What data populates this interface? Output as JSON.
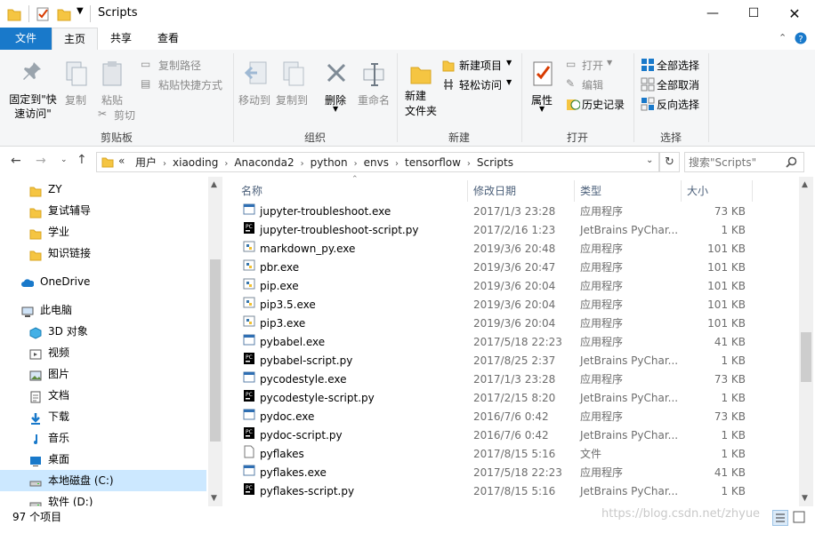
{
  "window": {
    "title": "Scripts"
  },
  "tabs": {
    "file": "文件",
    "home": "主页",
    "share": "共享",
    "view": "查看"
  },
  "ribbon": {
    "pin": "固定到\"快速访问\"",
    "copy": "复制",
    "paste": "粘贴",
    "copy_path": "复制路径",
    "paste_shortcut": "粘贴快捷方式",
    "cut": "剪切",
    "group_clipboard": "剪贴板",
    "move_to": "移动到",
    "copy_to": "复制到",
    "delete": "删除",
    "rename": "重命名",
    "group_organize": "组织",
    "new_folder": "新建\n文件夹",
    "new_item": "新建项目",
    "easy_access": "轻松访问",
    "group_new": "新建",
    "properties": "属性",
    "open": "打开",
    "edit": "编辑",
    "history": "历史记录",
    "group_open": "打开",
    "select_all": "全部选择",
    "select_none": "全部取消",
    "invert": "反向选择",
    "group_select": "选择"
  },
  "address": {
    "chevrons": "«",
    "path": [
      "用户",
      "xiaoding",
      "Anaconda2",
      "python",
      "envs",
      "tensorflow",
      "Scripts"
    ],
    "search_placeholder": "搜索\"Scripts\""
  },
  "nav": [
    {
      "label": "ZY",
      "icon": "folder-icon"
    },
    {
      "label": "复试辅导",
      "icon": "folder-icon"
    },
    {
      "label": "学业",
      "icon": "folder-icon"
    },
    {
      "label": "知识链接",
      "icon": "folder-icon"
    },
    {
      "label": "OneDrive",
      "icon": "cloud-icon"
    },
    {
      "label": "此电脑",
      "icon": "computer-icon"
    },
    {
      "label": "3D 对象",
      "icon": "cube-icon"
    },
    {
      "label": "视频",
      "icon": "video-icon"
    },
    {
      "label": "图片",
      "icon": "picture-icon"
    },
    {
      "label": "文档",
      "icon": "document-icon"
    },
    {
      "label": "下载",
      "icon": "download-icon"
    },
    {
      "label": "音乐",
      "icon": "music-icon"
    },
    {
      "label": "桌面",
      "icon": "desktop-icon"
    },
    {
      "label": "本地磁盘 (C:)",
      "icon": "drive-icon"
    },
    {
      "label": "软件 (D:)",
      "icon": "drive-icon"
    }
  ],
  "columns": {
    "name": "名称",
    "date": "修改日期",
    "type": "类型",
    "size": "大小"
  },
  "files": [
    {
      "name": "jupyter-troubleshoot.exe",
      "date": "2017/1/3 23:28",
      "type": "应用程序",
      "size": "73 KB",
      "icon": "exe-icon"
    },
    {
      "name": "jupyter-troubleshoot-script.py",
      "date": "2017/2/16 1:23",
      "type": "JetBrains PyChar...",
      "size": "1 KB",
      "icon": "pycharm-icon"
    },
    {
      "name": "markdown_py.exe",
      "date": "2019/3/6 20:48",
      "type": "应用程序",
      "size": "101 KB",
      "icon": "python-icon"
    },
    {
      "name": "pbr.exe",
      "date": "2019/3/6 20:47",
      "type": "应用程序",
      "size": "101 KB",
      "icon": "python-icon"
    },
    {
      "name": "pip.exe",
      "date": "2019/3/6 20:04",
      "type": "应用程序",
      "size": "101 KB",
      "icon": "python-icon"
    },
    {
      "name": "pip3.5.exe",
      "date": "2019/3/6 20:04",
      "type": "应用程序",
      "size": "101 KB",
      "icon": "python-icon"
    },
    {
      "name": "pip3.exe",
      "date": "2019/3/6 20:04",
      "type": "应用程序",
      "size": "101 KB",
      "icon": "python-icon"
    },
    {
      "name": "pybabel.exe",
      "date": "2017/5/18 22:23",
      "type": "应用程序",
      "size": "41 KB",
      "icon": "exe-icon"
    },
    {
      "name": "pybabel-script.py",
      "date": "2017/8/25 2:37",
      "type": "JetBrains PyChar...",
      "size": "1 KB",
      "icon": "pycharm-icon"
    },
    {
      "name": "pycodestyle.exe",
      "date": "2017/1/3 23:28",
      "type": "应用程序",
      "size": "73 KB",
      "icon": "exe-icon"
    },
    {
      "name": "pycodestyle-script.py",
      "date": "2017/2/15 8:20",
      "type": "JetBrains PyChar...",
      "size": "1 KB",
      "icon": "pycharm-icon"
    },
    {
      "name": "pydoc.exe",
      "date": "2016/7/6 0:42",
      "type": "应用程序",
      "size": "73 KB",
      "icon": "exe-icon"
    },
    {
      "name": "pydoc-script.py",
      "date": "2016/7/6 0:42",
      "type": "JetBrains PyChar...",
      "size": "1 KB",
      "icon": "pycharm-icon"
    },
    {
      "name": "pyflakes",
      "date": "2017/8/15 5:16",
      "type": "文件",
      "size": "1 KB",
      "icon": "file-icon"
    },
    {
      "name": "pyflakes.exe",
      "date": "2017/5/18 22:23",
      "type": "应用程序",
      "size": "41 KB",
      "icon": "exe-icon"
    },
    {
      "name": "pyflakes-script.py",
      "date": "2017/8/15 5:16",
      "type": "JetBrains PyChar...",
      "size": "1 KB",
      "icon": "pycharm-icon"
    }
  ],
  "status": {
    "count": "97 个项目"
  },
  "watermark": "https://blog.csdn.net/zhyue"
}
